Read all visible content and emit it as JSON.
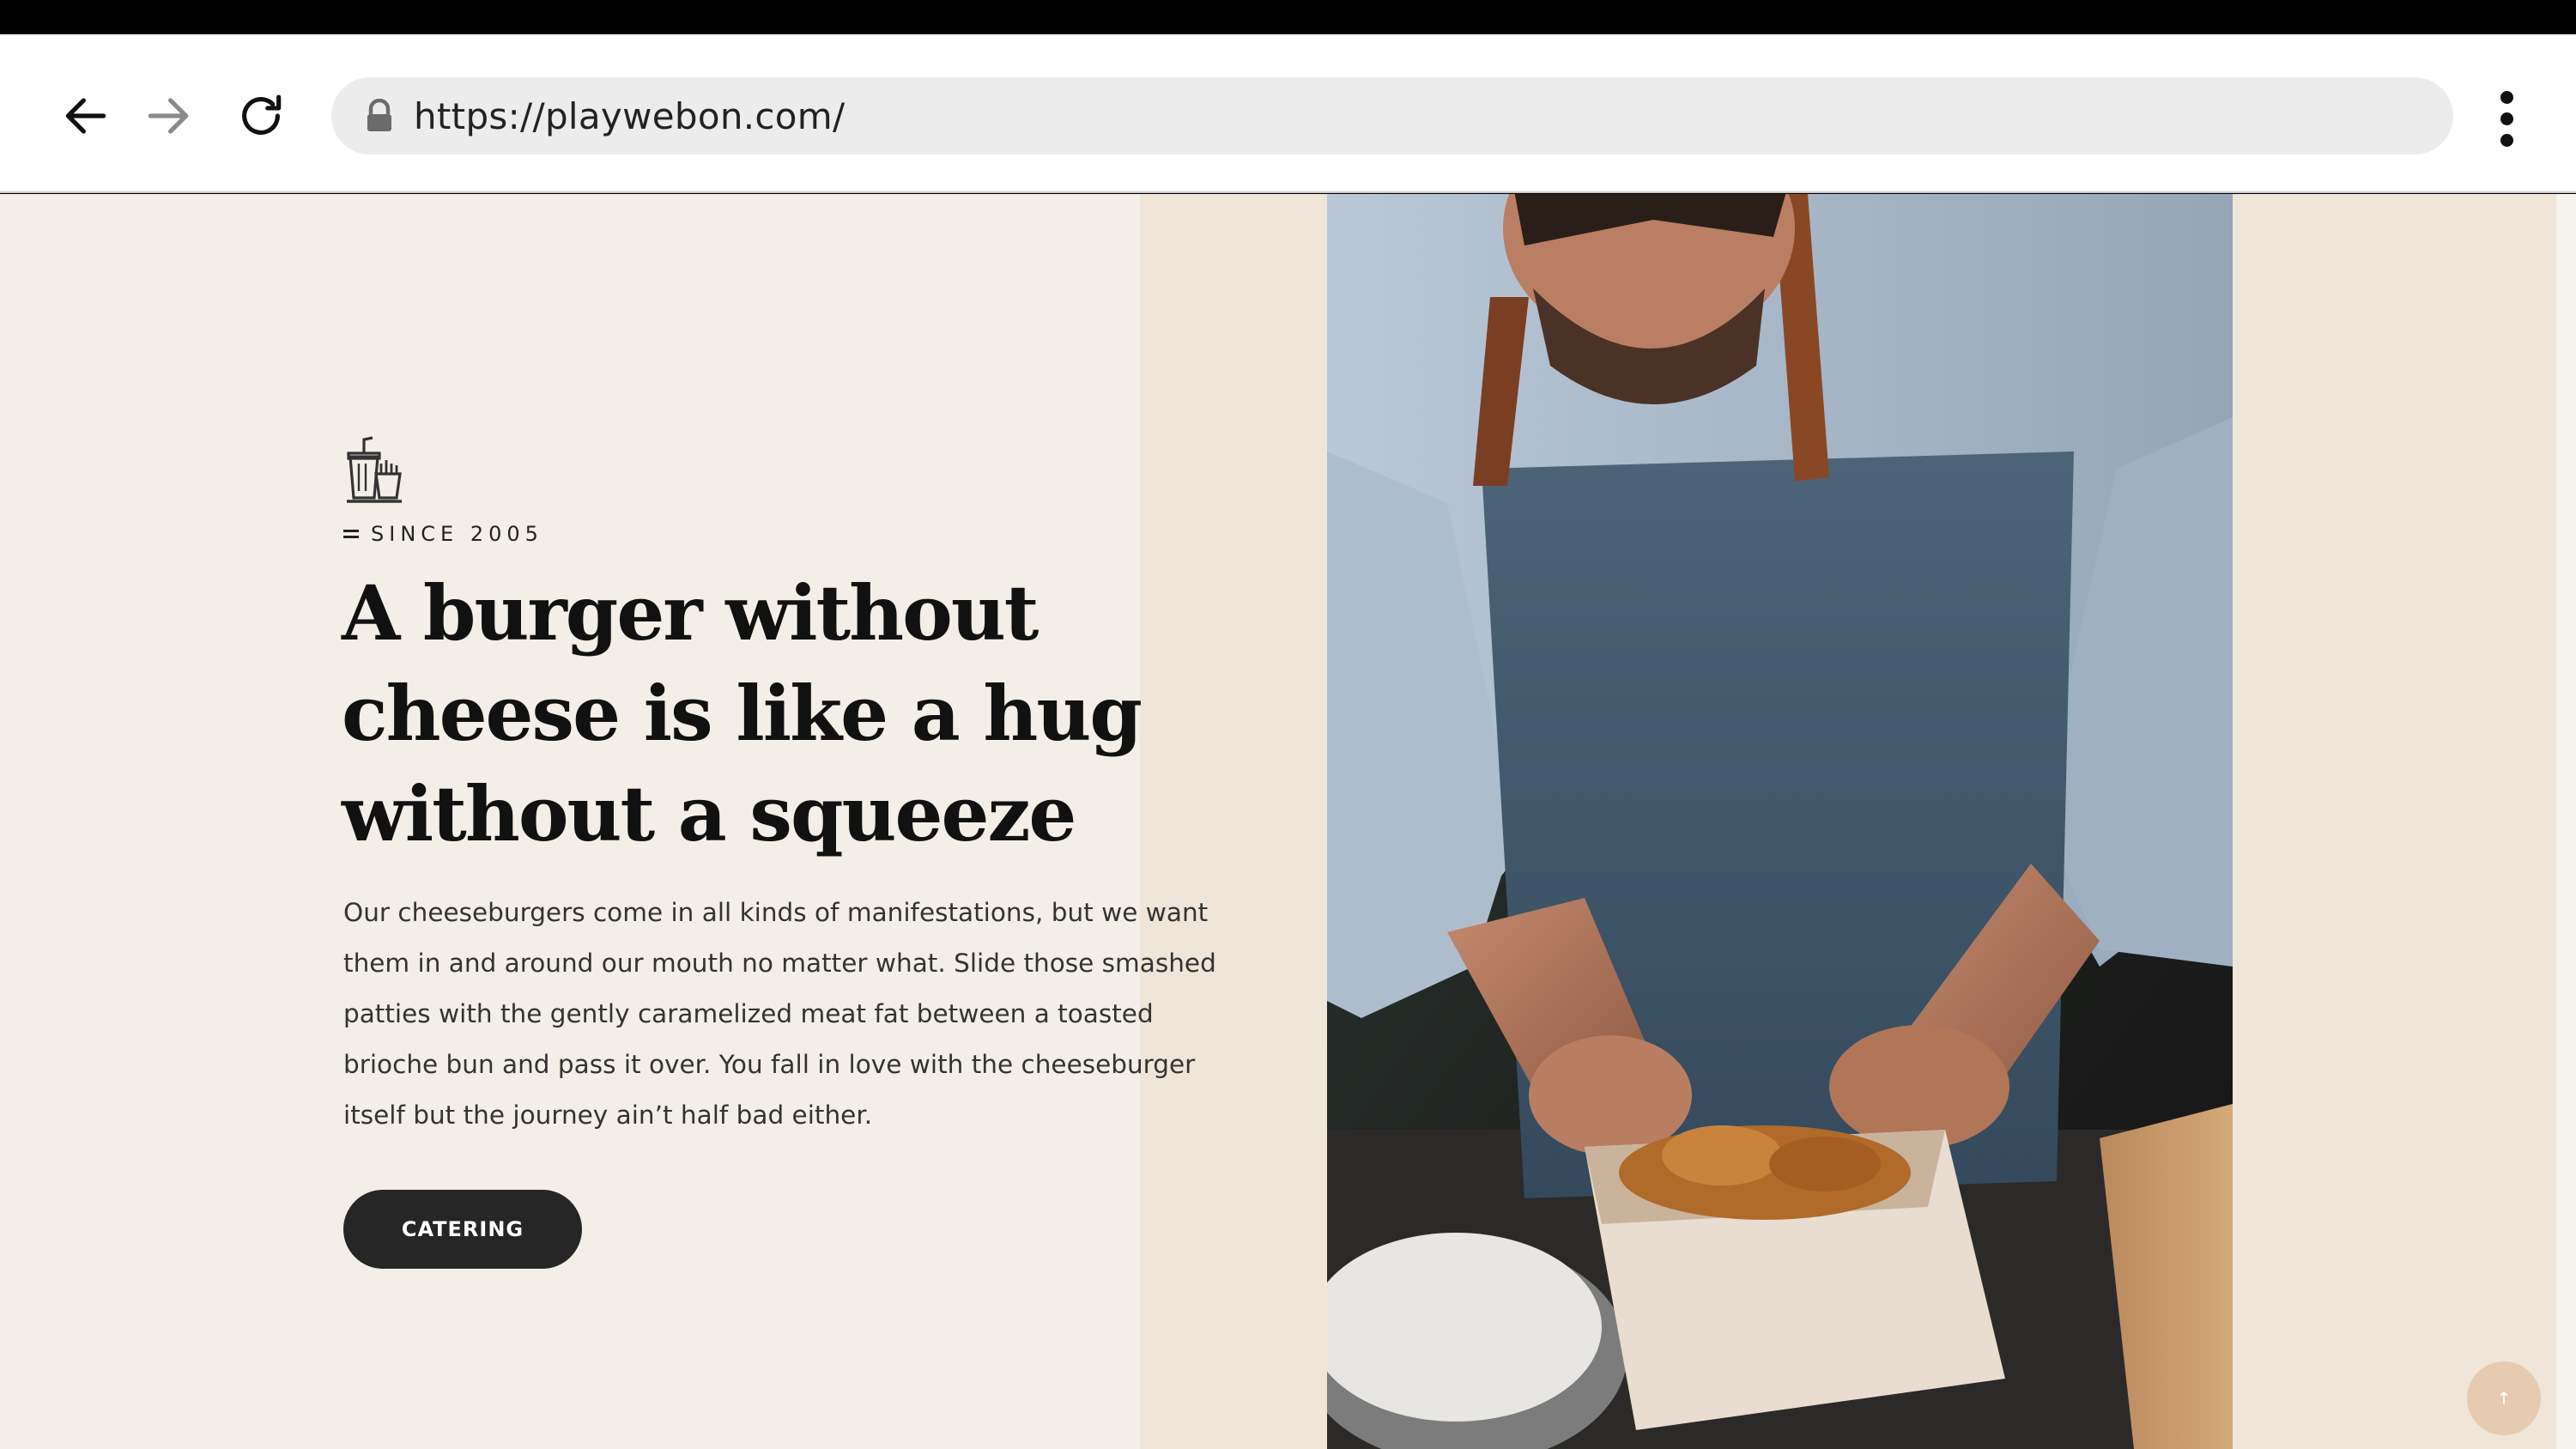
{
  "browser": {
    "url": "https://playwebon.com/",
    "back_icon": "arrow-left-icon",
    "forward_icon": "arrow-right-icon",
    "reload_icon": "reload-icon",
    "lock_icon": "lock-icon",
    "menu_icon": "kebab-menu-icon"
  },
  "hero": {
    "icon": "fast-food-icon",
    "eyebrow": "SINCE 2005",
    "headline": "A burger without cheese is like a hug without a squeeze",
    "body": "Our cheeseburgers come in all kinds of manifestations, but we want them in and around our mouth no matter what. Slide those smashed patties with the gently caramelized meat fat between a toasted brioche bun and pass it over. You fall in love with the cheeseburger itself but the journey ain’t half bad either.",
    "cta_label": "CATERING",
    "photo": "chef-packing-fried-chicken-photo"
  },
  "scroll_top": {
    "label": "↑",
    "icon": "arrow-up-icon"
  },
  "colors": {
    "page_bg": "#f3efe8",
    "panel_bg": "#efe5d8",
    "button_bg": "#262626",
    "scroll_top_bg": "#e6cbb0"
  }
}
